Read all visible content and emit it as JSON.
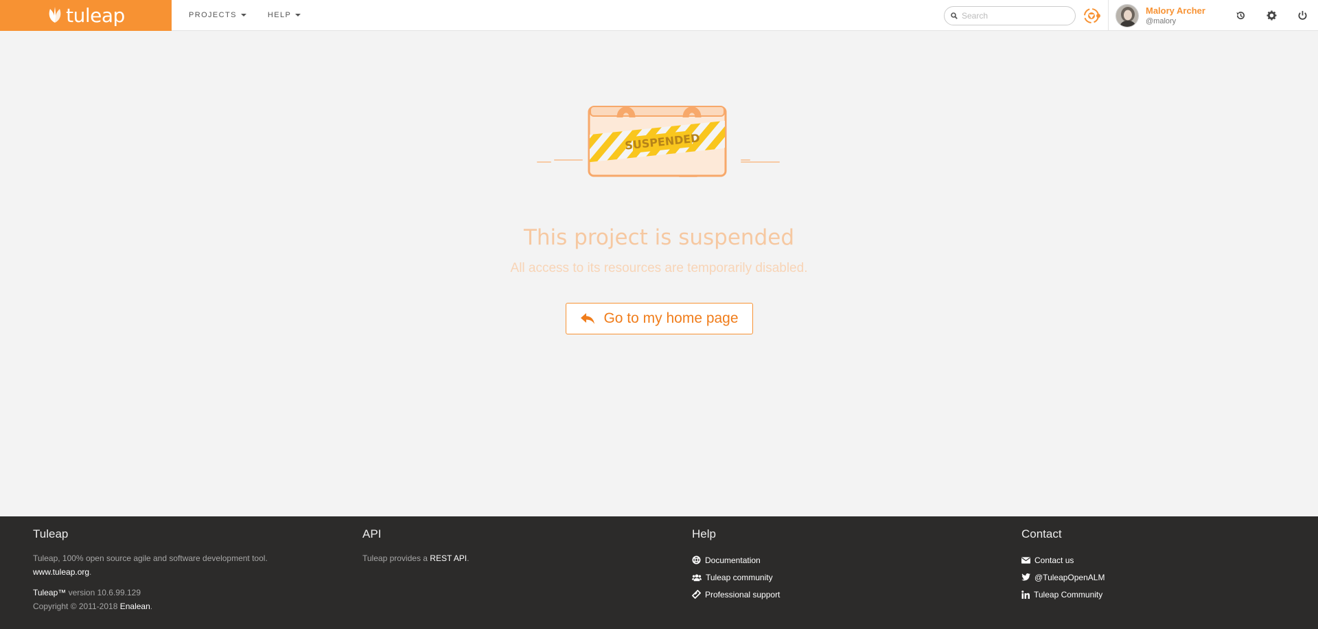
{
  "navbar": {
    "brand": "tuleap",
    "menu": [
      {
        "label": "PROJECTS"
      },
      {
        "label": "HELP"
      }
    ],
    "search_placeholder": "Search",
    "user": {
      "name": "Malory Archer",
      "login": "@malory"
    }
  },
  "illustration": {
    "stamp": "SUSPENDED"
  },
  "main": {
    "title": "This project is suspended",
    "subtitle": "All access to its resources are temporarily disabled.",
    "button_label": "Go to my home page"
  },
  "footer": {
    "tuleap": {
      "title": "Tuleap",
      "description": "Tuleap, 100% open source agile and software development tool.",
      "site_link": "www.tuleap.org",
      "version_brand": "Tuleap™",
      "version": "version 10.6.99.129",
      "copyright": "Copyright © 2011-2018",
      "company": "Enalean"
    },
    "api": {
      "title": "API",
      "text": "Tuleap provides a",
      "link": "REST API"
    },
    "help": {
      "title": "Help",
      "links": [
        "Documentation",
        "Tuleap community",
        "Professional support"
      ]
    },
    "contact": {
      "title": "Contact",
      "links": [
        "Contact us",
        "@TuleapOpenALM",
        "Tuleap Community"
      ]
    }
  },
  "colors": {
    "brand": "#f79233",
    "footer_bg": "#2c2b2a",
    "page_bg": "#f3f3f3"
  }
}
